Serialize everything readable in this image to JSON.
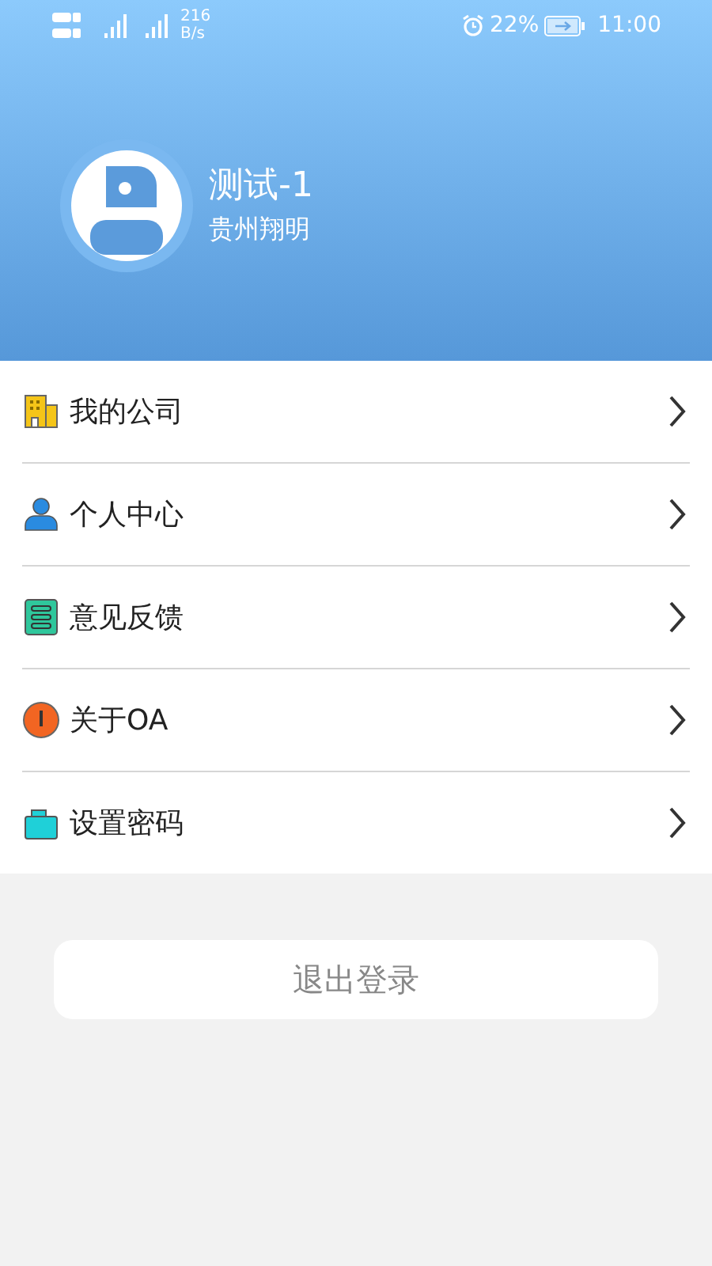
{
  "status_bar": {
    "net_speed": "216",
    "net_unit": "B/s",
    "battery": "22%",
    "time": "11:00"
  },
  "profile": {
    "name": "测试-1",
    "company": "贵州翔明"
  },
  "menu": [
    {
      "kind": "company",
      "label": "我的公司"
    },
    {
      "kind": "person",
      "label": "个人中心"
    },
    {
      "kind": "feedback",
      "label": "意见反馈"
    },
    {
      "kind": "about",
      "label": "关于OA"
    },
    {
      "kind": "password",
      "label": "设置密码"
    }
  ],
  "logout": "退出登录"
}
